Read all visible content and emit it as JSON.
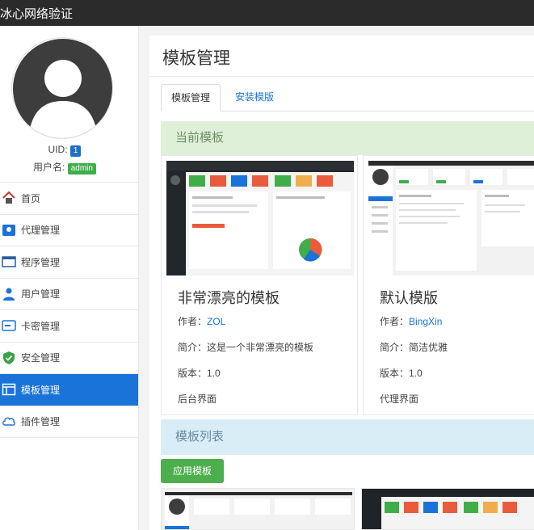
{
  "app": {
    "title": "冰心网络验证"
  },
  "user": {
    "uid_label": "UID:",
    "uid_value": "1",
    "username_label": "用户名:",
    "username_value": "admin"
  },
  "sidebar": {
    "items": [
      {
        "label": "首页",
        "icon": "home-icon"
      },
      {
        "label": "代理管理",
        "icon": "agent-icon"
      },
      {
        "label": "程序管理",
        "icon": "program-icon"
      },
      {
        "label": "用户管理",
        "icon": "users-icon"
      },
      {
        "label": "卡密管理",
        "icon": "card-key-icon"
      },
      {
        "label": "安全管理",
        "icon": "shield-icon"
      },
      {
        "label": "模板管理",
        "icon": "template-icon",
        "active": true
      },
      {
        "label": "插件管理",
        "icon": "plugin-icon"
      }
    ]
  },
  "page": {
    "title": "模板管理"
  },
  "tabs": [
    {
      "label": "模板管理",
      "active": true
    },
    {
      "label": "安装模版",
      "active": false
    }
  ],
  "current": {
    "heading": "当前模板"
  },
  "templates": [
    {
      "name": "非常漂亮的模板",
      "author_label": "作者：",
      "author": "ZOL",
      "intro": "简介：这是一个非常漂亮的模板",
      "version": "版本：1.0",
      "type": "后台界面"
    },
    {
      "name": "默认模版",
      "author_label": "作者：",
      "author": "BingXin",
      "intro": "简介：简洁优雅",
      "version": "版本：1.0",
      "type": "代理界面"
    }
  ],
  "list": {
    "heading": "模板列表",
    "apply_button": "应用模板"
  },
  "colors": {
    "topbar": "#2b2b2b",
    "active_nav": "#1a73d8",
    "success_panel": "#dff0d8",
    "info_panel": "#d9edf7",
    "apply_button": "#4cae4c",
    "badge_uid": "#1e6fbf",
    "badge_user": "#3fae49"
  }
}
